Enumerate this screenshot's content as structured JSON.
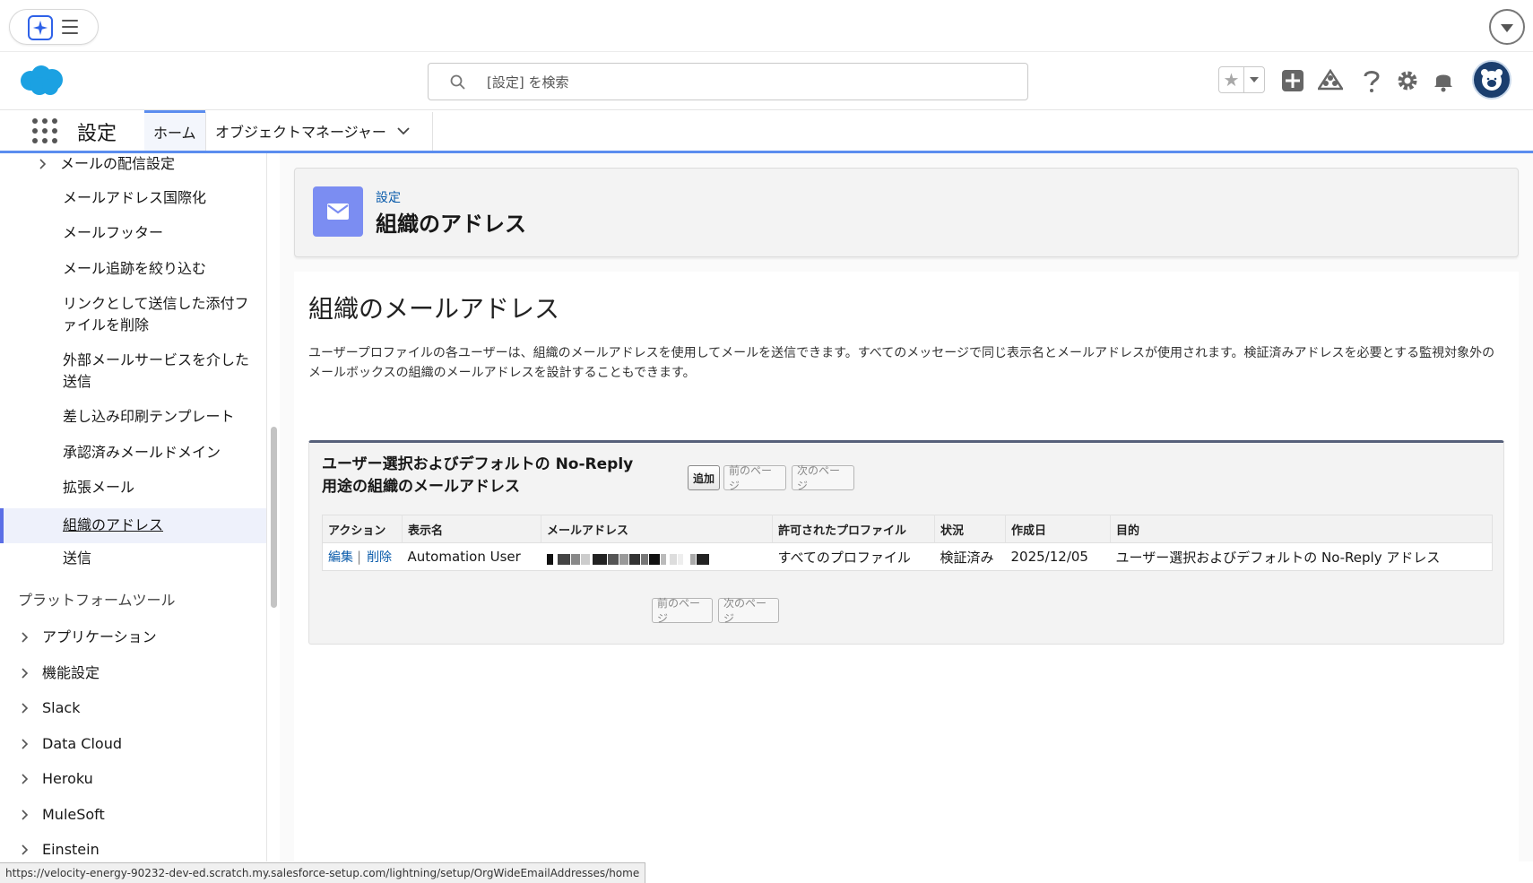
{
  "search": {
    "placeholder": "[設定] を検索"
  },
  "nav": {
    "app_name": "設定",
    "tabs": [
      {
        "label": "ホーム"
      },
      {
        "label": "オブジェクトマネージャー"
      }
    ]
  },
  "sidebar": {
    "items": [
      {
        "label": "メールの配信設定"
      },
      {
        "label": "メールアドレス国際化"
      },
      {
        "label": "メールフッター"
      },
      {
        "label": "メール追跡を絞り込む"
      },
      {
        "label": "リンクとして送信した添付ファイルを削除"
      },
      {
        "label": "外部メールサービスを介した送信"
      },
      {
        "label": "差し込み印刷テンプレート"
      },
      {
        "label": "承認済みメールドメイン"
      },
      {
        "label": "拡張メール"
      },
      {
        "label": "組織のアドレス"
      },
      {
        "label": "送信"
      }
    ],
    "section": "プラットフォームツール",
    "groups": [
      {
        "label": "アプリケーション"
      },
      {
        "label": "機能設定"
      },
      {
        "label": "Slack"
      },
      {
        "label": "Data Cloud"
      },
      {
        "label": "Heroku"
      },
      {
        "label": "MuleSoft"
      },
      {
        "label": "Einstein"
      }
    ]
  },
  "page_header": {
    "breadcrumb": "設定",
    "title": "組織のアドレス"
  },
  "main": {
    "heading": "組織のメールアドレス",
    "description": "ユーザープロファイルの各ユーザーは、組織のメールアドレスを使用してメールを送信できます。すべてのメッセージで同じ表示名とメールアドレスが使用されます。検証済みアドレスを必要とする監視対象外のメールボックスの組織のメールアドレスを設計することもできます。"
  },
  "panel": {
    "title": "ユーザー選択およびデフォルトの No-Reply 用途の組織のメールアドレス",
    "add_label": "追加",
    "prev_label": "前のページ",
    "next_label": "次のページ",
    "columns": [
      "アクション",
      "表示名",
      "メールアドレス",
      "許可されたプロファイル",
      "状況",
      "作成日",
      "目的"
    ],
    "rows": [
      {
        "edit": "編集",
        "pipe": "|",
        "delete": "削除",
        "display_name": "Automation User",
        "profiles": "すべてのプロファイル",
        "status": "検証済み",
        "created": "2025/12/05",
        "purpose": "ユーザー選択およびデフォルトの No-Reply アドレス"
      }
    ]
  },
  "statusbar": {
    "url": "https://velocity-energy-90232-dev-ed.scratch.my.salesforce-setup.com/lightning/setup/OrgWideEmailAddresses/home"
  },
  "colors": {
    "brand_blue": "#5b8def",
    "link": "#0b5cab",
    "icon_bg": "#7b8df2",
    "cloud": "#1ba1e2"
  }
}
